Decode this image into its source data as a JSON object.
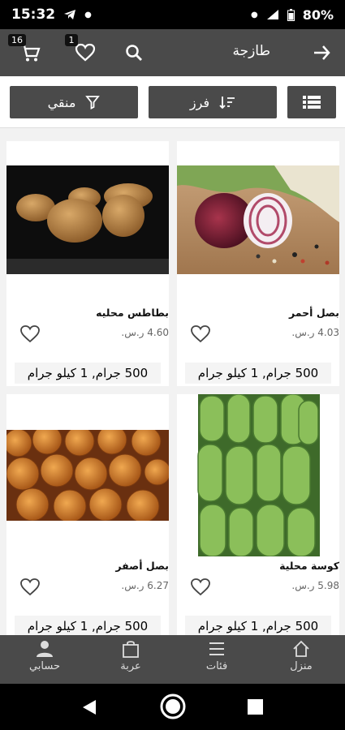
{
  "status": {
    "time": "15:32",
    "battery": "80%"
  },
  "header": {
    "title": "طازجة",
    "cart_badge": "16",
    "wishlist_badge": "1"
  },
  "filters": {
    "filter_label": "منقي",
    "sort_label": "فرز"
  },
  "products": [
    {
      "name": "بصل أحمر",
      "price": "4.03 ر.س.",
      "weight": "500 جرام, 1 كيلو جرام",
      "image": "red-onion"
    },
    {
      "name": "بطاطس محليه",
      "price": "4.60 ر.س.",
      "weight": "500 جرام, 1 كيلو جرام",
      "image": "potatoes"
    },
    {
      "name": "كوسة محلية",
      "price": "5.98 ر.س.",
      "weight": "500 جرام, 1 كيلو جرام",
      "image": "zucchini"
    },
    {
      "name": "بصل أصفر",
      "price": "6.27 ر.س.",
      "weight": "500 جرام, 1 كيلو جرام",
      "image": "yellow-onion"
    }
  ],
  "bottom_nav": {
    "home": "منزل",
    "categories": "فئات",
    "cart": "عربة",
    "account": "حسابي"
  },
  "colors": {
    "bar": "#4a4a4a",
    "background": "#f2f2f2"
  }
}
